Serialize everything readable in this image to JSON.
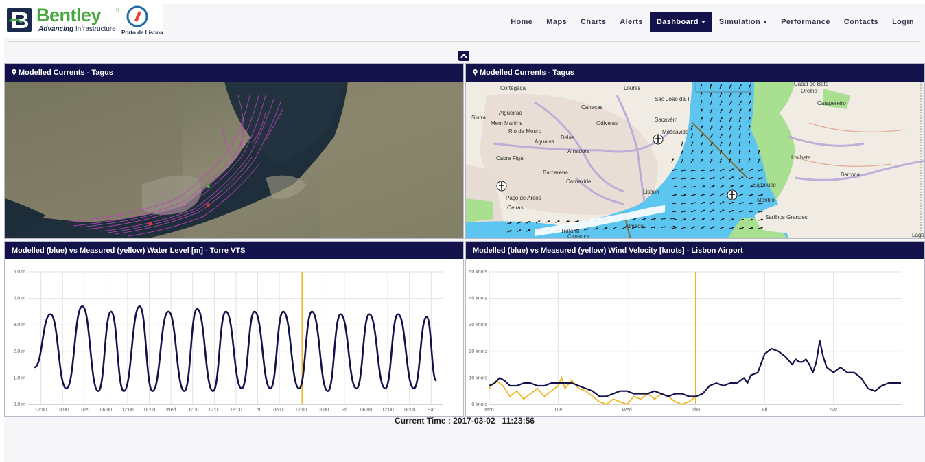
{
  "brand": {
    "name": "Bentley",
    "tagline_bold": "Advancing",
    "tagline_rest": "Infrastructure",
    "partner": "Porto de Lisboa"
  },
  "nav": {
    "items": [
      {
        "label": "Home",
        "active": false,
        "dropdown": false
      },
      {
        "label": "Maps",
        "active": false,
        "dropdown": false
      },
      {
        "label": "Charts",
        "active": false,
        "dropdown": false
      },
      {
        "label": "Alerts",
        "active": false,
        "dropdown": false
      },
      {
        "label": "Dashboard",
        "active": true,
        "dropdown": true
      },
      {
        "label": "Simulation",
        "active": false,
        "dropdown": true
      },
      {
        "label": "Performance",
        "active": false,
        "dropdown": false
      },
      {
        "label": "Contacts",
        "active": false,
        "dropdown": false
      },
      {
        "label": "Login",
        "active": false,
        "dropdown": false
      }
    ]
  },
  "panels": {
    "satellite": {
      "title": "Modelled Currents - Tagus"
    },
    "nautical": {
      "title": "Modelled Currents - Tagus",
      "places": [
        "Cortegaça",
        "Loures",
        "São João da T",
        "Casal do Bate",
        "Orelha",
        "Catapereiro",
        "Sintra",
        "Algueirao",
        "Mem Martins",
        "Caneças",
        "Odivelas",
        "Sacavém",
        "Moscavide",
        "Rio de Mouro",
        "Agualva",
        "Belas",
        "Amadora",
        "Cabra Figa",
        "Barcarena",
        "Carnaxide",
        "Lisbon",
        "Paço de Arcos",
        "Oeiras",
        "Almada",
        "Trafaria",
        "Caparica",
        "Samouco",
        "Montijo",
        "Barroca",
        "Lochete",
        "Sarilhos Grandes",
        "Lago"
      ]
    },
    "water_level": {
      "title": "Modelled (blue) vs Measured (yellow) Water Level [m] - Torre VTS"
    },
    "wind": {
      "title": "Modelled (blue) vs Measured (yellow) Wind Velocity [knots] - Lisbon Airport"
    }
  },
  "chart_data": [
    {
      "type": "line",
      "title": "Modelled (blue) vs Measured (yellow) Water Level [m] - Torre VTS",
      "y_tick_labels": [
        "0.0 m",
        "1.0 m",
        "2.0 m",
        "3.0 m",
        "4.0 m",
        "5.0 m"
      ],
      "x_tick_labels": [
        "12:00",
        "18:00",
        "Tue",
        "06:00",
        "12:00",
        "18:00",
        "Wed",
        "06:00",
        "12:00",
        "18:00",
        "Thu",
        "06:00",
        "12:00",
        "18:00",
        "Fri",
        "06:00",
        "12:00",
        "18:00",
        "Sat"
      ],
      "ylim": [
        0,
        5
      ],
      "x": [
        -2,
        3,
        8,
        13,
        18,
        22,
        26,
        31,
        35,
        40,
        45,
        49,
        54,
        58,
        63,
        67,
        72,
        76,
        81,
        85,
        90,
        94,
        99,
        103,
        108,
        112,
        117,
        121,
        124
      ],
      "now_x": 82,
      "series": [
        {
          "name": "Modelled",
          "color": "#14124a",
          "values": [
            1.4,
            3.4,
            0.6,
            3.7,
            0.5,
            3.5,
            0.5,
            3.7,
            0.5,
            3.5,
            0.5,
            3.6,
            0.5,
            3.5,
            0.6,
            3.5,
            0.6,
            3.5,
            0.6,
            3.5,
            0.5,
            3.4,
            0.6,
            3.4,
            0.6,
            3.4,
            0.6,
            3.3,
            0.9
          ]
        }
      ],
      "grid": true,
      "measured_color": "#f0b422"
    },
    {
      "type": "line",
      "title": "Modelled (blue) vs Measured (yellow) Wind Velocity [knots] - Lisbon Airport",
      "y_tick_labels": [
        "0 knots",
        "10 knots",
        "20 knots",
        "30 knots",
        "40 knots",
        "50 knots"
      ],
      "x_tick_labels": [
        "Mon",
        "Tue",
        "Wed",
        "Thu",
        "Fri",
        "Sat"
      ],
      "ylim": [
        0,
        50
      ],
      "xlim": [
        0,
        6
      ],
      "now_x": 3.0,
      "series": [
        {
          "name": "Modelled",
          "color": "#14124a",
          "x": [
            0.0,
            0.08,
            0.15,
            0.22,
            0.3,
            0.4,
            0.5,
            0.6,
            0.7,
            0.8,
            0.9,
            1.0,
            1.1,
            1.2,
            1.3,
            1.4,
            1.5,
            1.6,
            1.7,
            1.8,
            1.9,
            2.0,
            2.1,
            2.2,
            2.3,
            2.4,
            2.5,
            2.6,
            2.7,
            2.8,
            2.9,
            3.0,
            3.1,
            3.2,
            3.3,
            3.4,
            3.5,
            3.6,
            3.7,
            3.75,
            3.8,
            3.9,
            4.0,
            4.1,
            4.2,
            4.3,
            4.4,
            4.45,
            4.5,
            4.55,
            4.6,
            4.65,
            4.7,
            4.75,
            4.8,
            4.85,
            4.9,
            5.0,
            5.1,
            5.2,
            5.3,
            5.4,
            5.5,
            5.6,
            5.7,
            5.8,
            5.9,
            5.98
          ],
          "values": [
            7,
            8,
            10,
            9,
            7,
            7,
            8,
            8,
            7,
            7,
            8,
            8,
            8,
            8,
            7,
            6,
            5,
            3,
            3,
            4,
            5,
            5,
            4,
            4,
            4,
            5,
            4,
            3,
            4,
            4,
            3,
            3,
            4,
            7,
            8,
            7,
            8,
            8,
            10,
            8,
            11,
            12,
            19,
            21,
            20,
            18,
            15,
            17,
            16,
            16,
            17,
            15,
            12,
            16,
            24,
            18,
            14,
            12,
            14,
            12,
            12,
            10,
            6,
            5,
            7,
            8,
            8,
            8
          ]
        },
        {
          "name": "Measured",
          "color": "#f0b422",
          "x": [
            0.0,
            0.1,
            0.2,
            0.3,
            0.4,
            0.5,
            0.6,
            0.7,
            0.8,
            0.9,
            1.0,
            1.05,
            1.1,
            1.2,
            1.3,
            1.4,
            1.5,
            1.6,
            1.7,
            1.8,
            1.9,
            2.0,
            2.1,
            2.2,
            2.3,
            2.4,
            2.5,
            2.6,
            2.7,
            2.8,
            2.9,
            3.0
          ],
          "values": [
            6,
            9,
            7,
            3,
            5,
            2,
            4,
            6,
            3,
            5,
            7,
            10,
            6,
            9,
            6,
            5,
            3,
            1,
            0,
            2,
            1,
            0,
            3,
            2,
            4,
            2,
            4,
            3,
            1,
            0,
            1,
            3
          ]
        }
      ],
      "grid": true,
      "now_color": "#f0b422"
    }
  ],
  "footer": {
    "current_time": "Current Time : 2017-03-02   11:23:56"
  },
  "colors": {
    "navy": "#14124a",
    "brand_green": "#4aa63e",
    "measured_yellow": "#f0b422",
    "water": "#5cc6f0",
    "land": "#f0ece4"
  }
}
